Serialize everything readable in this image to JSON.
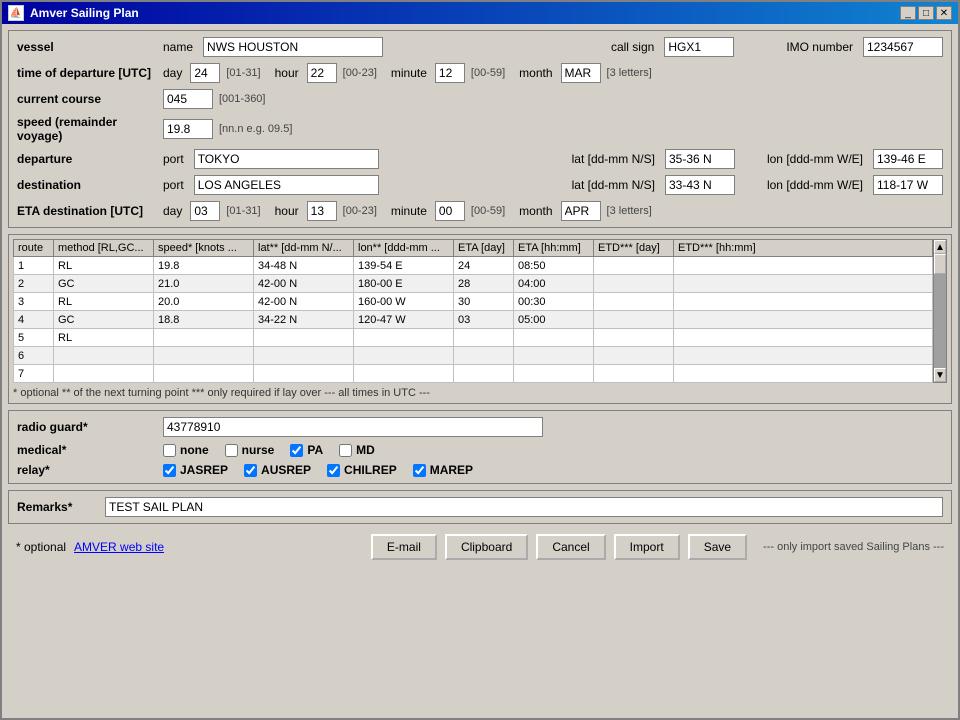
{
  "window": {
    "title": "Amver Sailing Plan",
    "title_icon": "⛵"
  },
  "vessel": {
    "label": "vessel",
    "name_label": "name",
    "name_value": "NWS HOUSTON",
    "call_sign_label": "call sign",
    "call_sign_value": "HGX1",
    "imo_label": "IMO number",
    "imo_value": "1234567"
  },
  "departure_time": {
    "label": "time of departure [UTC]",
    "day_label": "day",
    "day_value": "24",
    "day_hint": "[01-31]",
    "hour_label": "hour",
    "hour_value": "22",
    "hour_hint": "[00-23]",
    "minute_label": "minute",
    "minute_value": "12",
    "minute_hint": "[00-59]",
    "month_label": "month",
    "month_value": "MAR",
    "month_hint": "[3 letters]"
  },
  "current_course": {
    "label": "current course",
    "value": "045",
    "hint": "[001-360]"
  },
  "speed": {
    "label": "speed (remainder voyage)",
    "value": "19.8",
    "hint": "[nn.n e.g. 09.5]"
  },
  "departure": {
    "label": "departure",
    "port_label": "port",
    "port_value": "TOKYO",
    "lat_label": "lat [dd-mm N/S]",
    "lat_value": "35-36 N",
    "lon_label": "lon [ddd-mm W/E]",
    "lon_value": "139-46 E"
  },
  "destination": {
    "label": "destination",
    "port_label": "port",
    "port_value": "LOS ANGELES",
    "lat_label": "lat [dd-mm N/S]",
    "lat_value": "33-43 N",
    "lon_label": "lon [ddd-mm W/E]",
    "lon_value": "118-17 W"
  },
  "eta": {
    "label": "ETA destination [UTC]",
    "day_label": "day",
    "day_value": "03",
    "day_hint": "[01-31]",
    "hour_label": "hour",
    "hour_value": "13",
    "hour_hint": "[00-23]",
    "minute_label": "minute",
    "minute_value": "00",
    "minute_hint": "[00-59]",
    "month_label": "month",
    "month_value": "APR",
    "month_hint": "[3 letters]"
  },
  "route_table": {
    "columns": [
      "route",
      "method [RL,GC...",
      "speed* [knots ...",
      "lat** [dd-mm N/...",
      "lon** [ddd-mm ...",
      "ETA [day]",
      "ETA [hh:mm]",
      "ETD*** [day]",
      "ETD*** [hh:mm]"
    ],
    "rows": [
      {
        "route": "1",
        "method": "RL",
        "speed": "19.8",
        "lat": "34-48 N",
        "lon": "139-54 E",
        "eta_day": "24",
        "eta_hhmm": "08:50",
        "etd_day": "",
        "etd_hhmm": ""
      },
      {
        "route": "2",
        "method": "GC",
        "speed": "21.0",
        "lat": "42-00 N",
        "lon": "180-00 E",
        "eta_day": "28",
        "eta_hhmm": "04:00",
        "etd_day": "",
        "etd_hhmm": ""
      },
      {
        "route": "3",
        "method": "RL",
        "speed": "20.0",
        "lat": "42-00 N",
        "lon": "160-00 W",
        "eta_day": "30",
        "eta_hhmm": "00:30",
        "etd_day": "",
        "etd_hhmm": ""
      },
      {
        "route": "4",
        "method": "GC",
        "speed": "18.8",
        "lat": "34-22 N",
        "lon": "120-47 W",
        "eta_day": "03",
        "eta_hhmm": "05:00",
        "etd_day": "",
        "etd_hhmm": ""
      },
      {
        "route": "5",
        "method": "RL",
        "speed": "",
        "lat": "",
        "lon": "",
        "eta_day": "",
        "eta_hhmm": "",
        "etd_day": "",
        "etd_hhmm": ""
      },
      {
        "route": "6",
        "method": "",
        "speed": "",
        "lat": "",
        "lon": "",
        "eta_day": "",
        "eta_hhmm": "",
        "etd_day": "",
        "etd_hhmm": ""
      },
      {
        "route": "7",
        "method": "",
        "speed": "",
        "lat": "",
        "lon": "",
        "eta_day": "",
        "eta_hhmm": "",
        "etd_day": "",
        "etd_hhmm": ""
      }
    ],
    "note": "* optional   ** of the next turning point   *** only required if lay over          --- all times in UTC ---"
  },
  "radio_guard": {
    "label": "radio guard*",
    "value": "43778910"
  },
  "medical": {
    "label": "medical*",
    "options": [
      {
        "name": "none",
        "checked": false
      },
      {
        "name": "nurse",
        "checked": false
      },
      {
        "name": "PA",
        "checked": true
      },
      {
        "name": "MD",
        "checked": false
      }
    ]
  },
  "relay": {
    "label": "relay*",
    "options": [
      {
        "name": "JASREP",
        "checked": true
      },
      {
        "name": "AUSREP",
        "checked": true
      },
      {
        "name": "CHILREP",
        "checked": true
      },
      {
        "name": "MAREP",
        "checked": true
      }
    ]
  },
  "remarks": {
    "label": "Remarks*",
    "value": "TEST SAIL PLAN"
  },
  "bottom": {
    "optional_note": "* optional",
    "amver_link": "AMVER web site",
    "email_btn": "E-mail",
    "clipboard_btn": "Clipboard",
    "cancel_btn": "Cancel",
    "import_btn": "Import",
    "save_btn": "Save",
    "import_note": "--- only import saved Sailing Plans ---"
  }
}
